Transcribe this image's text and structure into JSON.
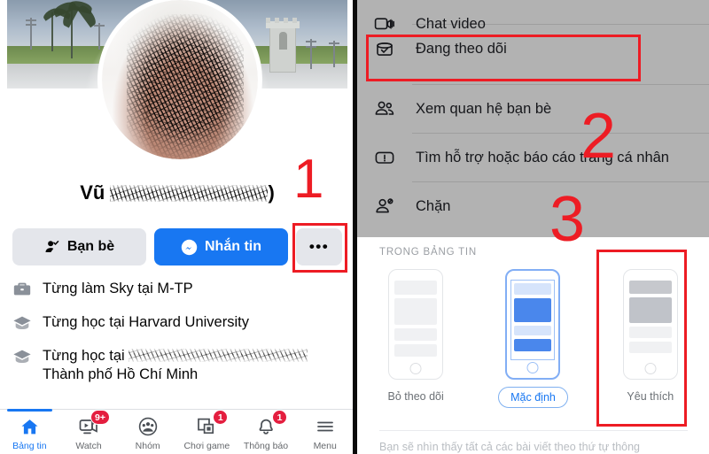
{
  "profile": {
    "name_prefix": "Vũ",
    "name_suffix": ")",
    "name_redacted_note": "redacted-scribble",
    "buttons": {
      "friends": "Bạn bè",
      "message": "Nhắn tin",
      "more": "•••"
    },
    "info": [
      {
        "icon": "briefcase-icon",
        "text": "Từng làm Sky tại M-TP",
        "redacted": false
      },
      {
        "icon": "graduation-cap-icon",
        "text": "Từng học tại Harvard University",
        "redacted": false
      },
      {
        "icon": "graduation-cap-icon",
        "text_before": "Từng học tại ",
        "text_after": "Thành phố Hồ Chí Minh",
        "redacted": true
      }
    ]
  },
  "tabbar": {
    "items": [
      {
        "label": "Bảng tin",
        "icon": "home-icon",
        "active": true,
        "badge": ""
      },
      {
        "label": "Watch",
        "icon": "video-icon",
        "active": false,
        "badge": "9+"
      },
      {
        "label": "Nhóm",
        "icon": "groups-icon",
        "active": false,
        "badge": ""
      },
      {
        "label": "Chơi game",
        "icon": "gamepad-icon",
        "active": false,
        "badge": "1"
      },
      {
        "label": "Thông báo",
        "icon": "bell-icon",
        "active": false,
        "badge": "1"
      },
      {
        "label": "Menu",
        "icon": "hamburger-icon",
        "active": false,
        "badge": ""
      }
    ]
  },
  "menu": {
    "items": [
      {
        "label": "Chat video",
        "icon": "video-camera-icon",
        "highlighted": false
      },
      {
        "label": "Đang theo dõi",
        "icon": "following-check-icon",
        "highlighted": true
      },
      {
        "label": "Xem quan hệ bạn bè",
        "icon": "two-people-icon",
        "highlighted": false
      },
      {
        "label": "Tìm hỗ trợ hoặc báo cáo trang cá nhân",
        "icon": "report-exclamation-icon",
        "highlighted": false
      },
      {
        "label": "Chặn",
        "icon": "block-person-icon",
        "highlighted": false
      }
    ]
  },
  "feed_settings": {
    "section_title": "TRONG BẢNG TIN",
    "options": [
      {
        "label": "Bỏ theo dõi",
        "selected": false,
        "highlighted": false
      },
      {
        "label": "Mặc định",
        "selected": true,
        "highlighted": false
      },
      {
        "label": "Yêu thích",
        "selected": false,
        "highlighted": true
      }
    ],
    "footer_text": "Bạn sẽ nhìn thấy tất cả các bài viết theo thứ tự thông"
  },
  "annotations": {
    "steps": [
      "1",
      "2",
      "3"
    ],
    "accent_color": "#ed1c24"
  },
  "colors": {
    "facebook_blue": "#1877f2",
    "button_grey": "#e4e6eb",
    "overlay_grey": "#b2b2b2",
    "badge_red": "#e41e3f",
    "annotation_red": "#ed1c24"
  }
}
